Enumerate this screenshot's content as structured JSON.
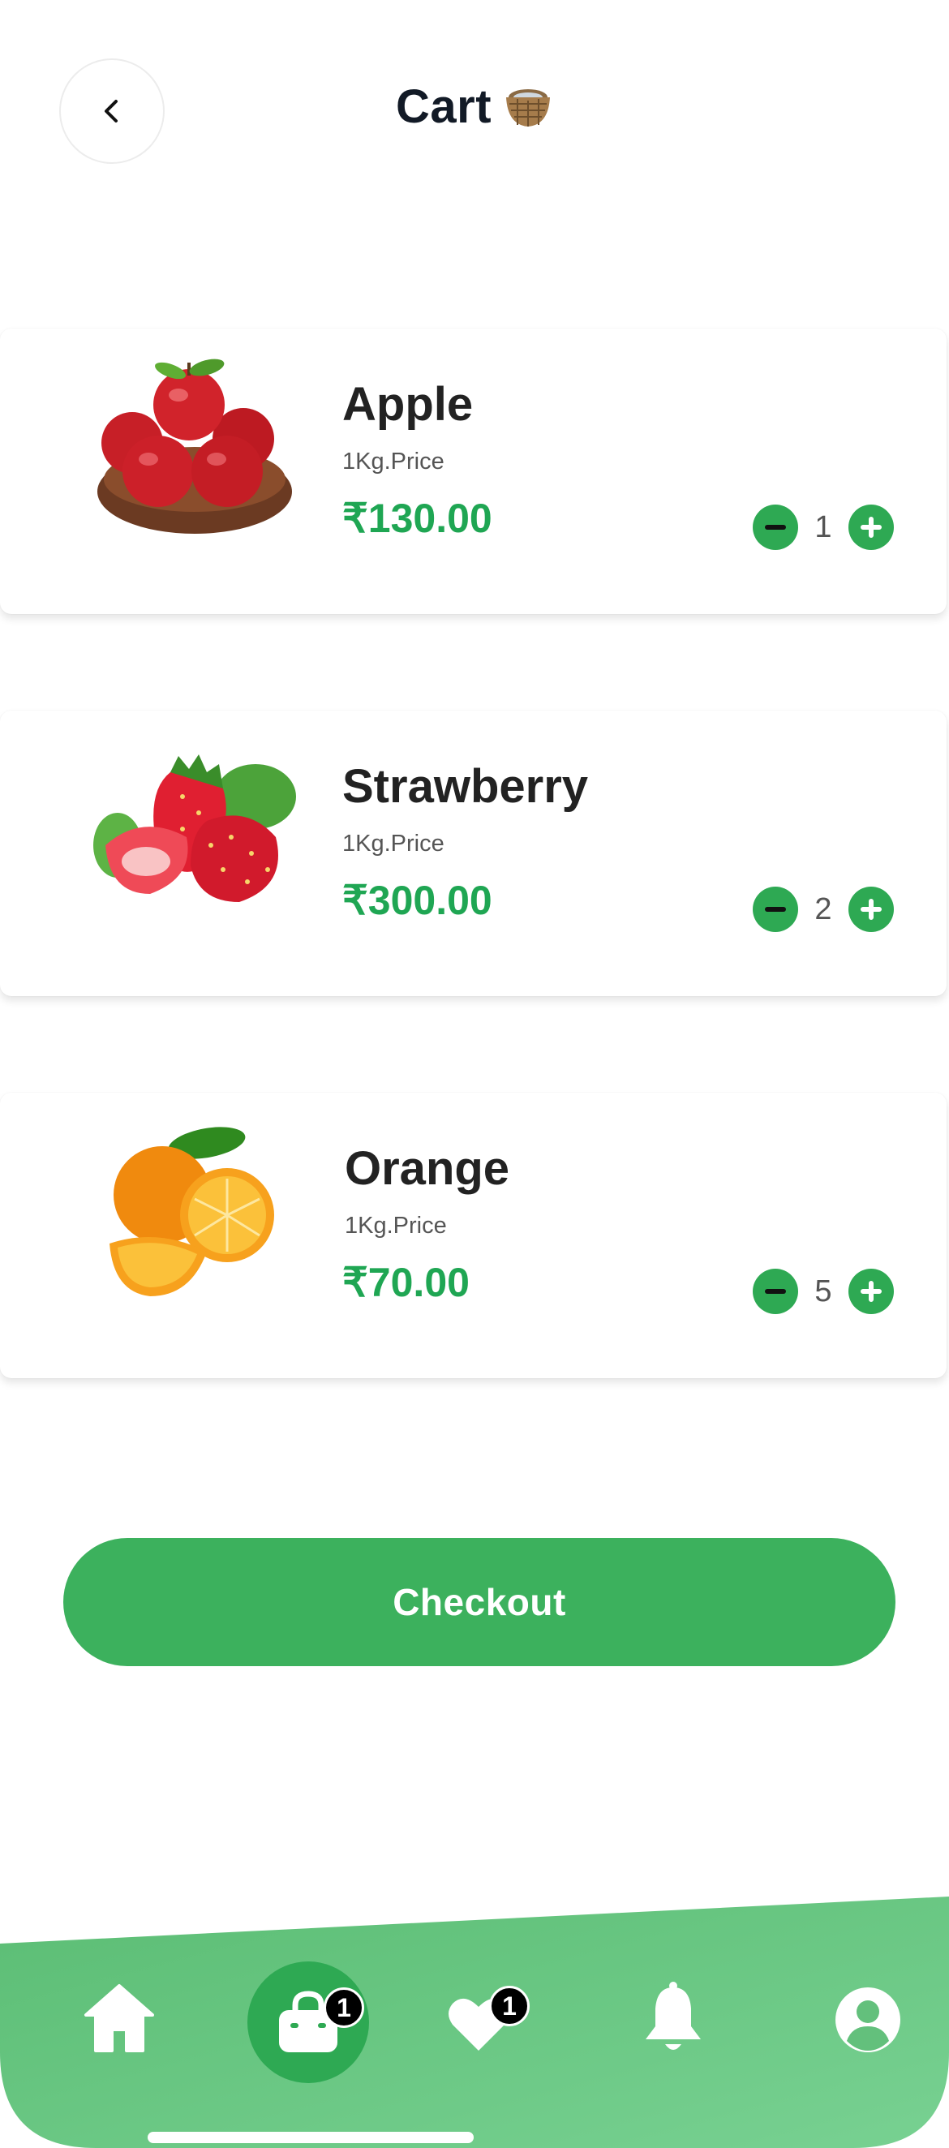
{
  "header": {
    "title": "Cart",
    "title_emoji": "🧺",
    "back_icon": "chevron-left-icon"
  },
  "cart": {
    "items": [
      {
        "name": "Apple",
        "unit": "1Kg.Price",
        "price": "₹130.00",
        "qty": "1",
        "image": "apple-image"
      },
      {
        "name": "Strawberry",
        "unit": "1Kg.Price",
        "price": "₹300.00",
        "qty": "2",
        "image": "strawberry-image"
      },
      {
        "name": "Orange",
        "unit": "1Kg.Price",
        "price": "₹70.00",
        "qty": "5",
        "image": "orange-image"
      }
    ]
  },
  "checkout": {
    "label": "Checkout"
  },
  "bottom_nav": {
    "items": [
      {
        "icon": "home-icon"
      },
      {
        "icon": "shopping-bag-icon",
        "badge": "1",
        "active": true
      },
      {
        "icon": "heart-icon",
        "badge": "1"
      },
      {
        "icon": "bell-icon"
      },
      {
        "icon": "user-icon"
      }
    ]
  },
  "colors": {
    "accent": "#3cb15d",
    "price": "#1fa653",
    "nav_gradient_start": "#5bbd74",
    "nav_gradient_end": "#78d192",
    "badge": "#000000"
  }
}
